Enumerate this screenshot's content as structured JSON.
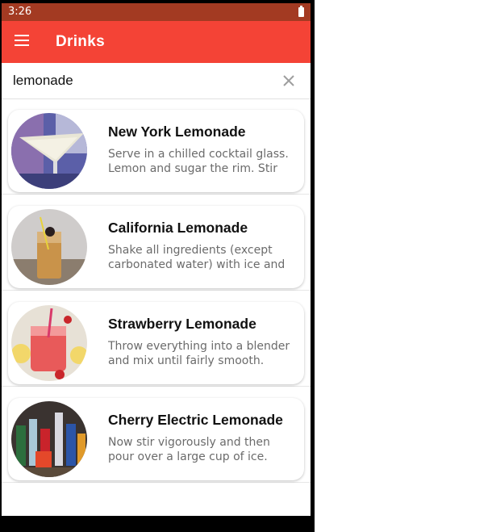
{
  "status": {
    "time": "3:26"
  },
  "appbar": {
    "title": "Drinks"
  },
  "search": {
    "value": "lemonade"
  },
  "drinks": [
    {
      "name": "New York Lemonade",
      "description": "Serve in a chilled cocktail glass. Lemon and sugar the rim. Stir and"
    },
    {
      "name": "California Lemonade",
      "description": "Shake all ingredients (except carbonated water) with ice and"
    },
    {
      "name": "Strawberry Lemonade",
      "description": "Throw everything into a blender and mix until fairly smooth. Serve"
    },
    {
      "name": "Cherry Electric Lemonade",
      "description": "Now stir vigorously and then pour over a large cup of ice."
    }
  ],
  "colors": {
    "appbar": "#f44336",
    "statusbar": "#a33a22",
    "cursor": "#c62828"
  }
}
